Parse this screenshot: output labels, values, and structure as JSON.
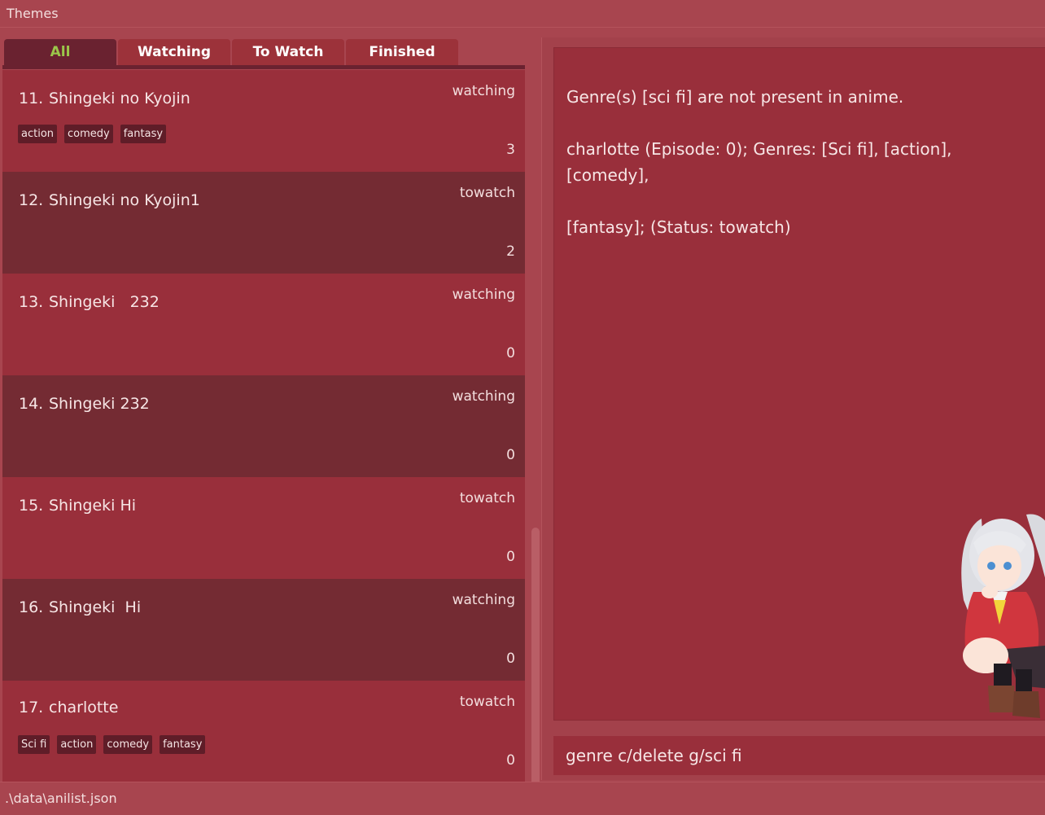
{
  "menu": {
    "themes_label": "Themes"
  },
  "tabs": [
    {
      "label": "All",
      "active": true
    },
    {
      "label": "Watching",
      "active": false
    },
    {
      "label": "To Watch",
      "active": false
    },
    {
      "label": "Finished",
      "active": false
    }
  ],
  "anime_list": [
    {
      "index": "11.",
      "title": "Shingeki no Kyojin",
      "status": "watching",
      "episode": "3",
      "genres": [
        "action",
        "comedy",
        "fantasy"
      ]
    },
    {
      "index": "12.",
      "title": "Shingeki no Kyojin1",
      "status": "towatch",
      "episode": "2",
      "genres": []
    },
    {
      "index": "13.",
      "title": "Shingeki   232",
      "status": "watching",
      "episode": "0",
      "genres": []
    },
    {
      "index": "14.",
      "title": "Shingeki 232",
      "status": "watching",
      "episode": "0",
      "genres": []
    },
    {
      "index": "15.",
      "title": "Shingeki Hi",
      "status": "towatch",
      "episode": "0",
      "genres": []
    },
    {
      "index": "16.",
      "title": "Shingeki  Hi",
      "status": "watching",
      "episode": "0",
      "genres": []
    },
    {
      "index": "17.",
      "title": "charlotte",
      "status": "towatch",
      "episode": "0",
      "genres": [
        "Sci fi",
        "action",
        "comedy",
        "fantasy"
      ]
    }
  ],
  "result": {
    "line1": "Genre(s) [sci fi] are not present in anime.",
    "line2": "charlotte (Episode: 0); Genres: [Sci fi], [action], [comedy],",
    "line3": "[fantasy]; (Status: towatch)"
  },
  "command": {
    "value": "genre c/delete g/sci fi"
  },
  "status_bar": {
    "path": ".\\data\\anilist.json"
  },
  "colors": {
    "background": "#a8454f",
    "card_light": "#992f3b",
    "card_dark": "#742b33",
    "tab_active": "#6a2230",
    "tab_active_text": "#9bc64a",
    "genre_tag": "#5f1d28"
  },
  "mascot": {
    "icon": "anime-girl-mascot"
  }
}
